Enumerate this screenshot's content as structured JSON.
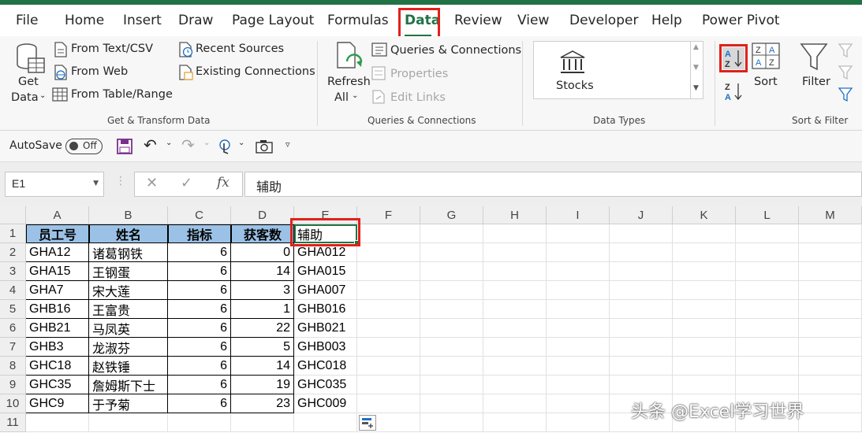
{
  "tabs": [
    "File",
    "Home",
    "Insert",
    "Draw",
    "Page Layout",
    "Formulas",
    "Data",
    "Review",
    "View",
    "Developer",
    "Help",
    "Power Pivot"
  ],
  "active_tab": "Data",
  "ribbon": {
    "get_data": {
      "line1": "Get",
      "line2": "Data"
    },
    "from_text_csv": "From Text/CSV",
    "from_web": "From Web",
    "from_table_range": "From Table/Range",
    "recent_sources": "Recent Sources",
    "existing_connections": "Existing Connections",
    "group_get_transform": "Get & Transform Data",
    "refresh_all": {
      "line1": "Refresh",
      "line2": "All"
    },
    "queries_connections": "Queries & Connections",
    "properties": "Properties",
    "edit_links": "Edit Links",
    "group_queries": "Queries & Connections",
    "stocks": "Stocks",
    "group_data_types": "Data Types",
    "sort": "Sort",
    "filter": "Filter",
    "group_sort_filter": "Sort & Filter"
  },
  "qat": {
    "autosave": "AutoSave",
    "toggle_state": "Off"
  },
  "formula_bar": {
    "name_box": "E1",
    "content": "辅助"
  },
  "columns": [
    "A",
    "B",
    "C",
    "D",
    "E",
    "F",
    "G",
    "H",
    "I",
    "J",
    "K",
    "L",
    "M"
  ],
  "rows": [
    "1",
    "2",
    "3",
    "4",
    "5",
    "6",
    "7",
    "8",
    "9",
    "10",
    "11"
  ],
  "sheet": {
    "headers": [
      "员工号",
      "姓名",
      "指标",
      "获客数",
      "辅助"
    ],
    "data": [
      [
        "GHA12",
        "诸葛钢铁",
        "6",
        "0",
        "GHA012"
      ],
      [
        "GHA15",
        "王钢蛋",
        "6",
        "14",
        "GHA015"
      ],
      [
        "GHA7",
        "宋大莲",
        "6",
        "3",
        "GHA007"
      ],
      [
        "GHB16",
        "王富贵",
        "6",
        "1",
        "GHB016"
      ],
      [
        "GHB21",
        "马凤英",
        "6",
        "22",
        "GHB021"
      ],
      [
        "GHB3",
        "龙淑芬",
        "6",
        "5",
        "GHB003"
      ],
      [
        "GHC18",
        "赵铁锤",
        "6",
        "14",
        "GHC018"
      ],
      [
        "GHC35",
        "詹姆斯下士",
        "6",
        "19",
        "GHC035"
      ],
      [
        "GHC9",
        "于予菊",
        "6",
        "23",
        "GHC009"
      ]
    ]
  },
  "watermark": "头条 @Excel学习世界",
  "colors": {
    "accent": "#217346",
    "highlight": "#e0211b",
    "header_fill": "#9bc2e6"
  }
}
